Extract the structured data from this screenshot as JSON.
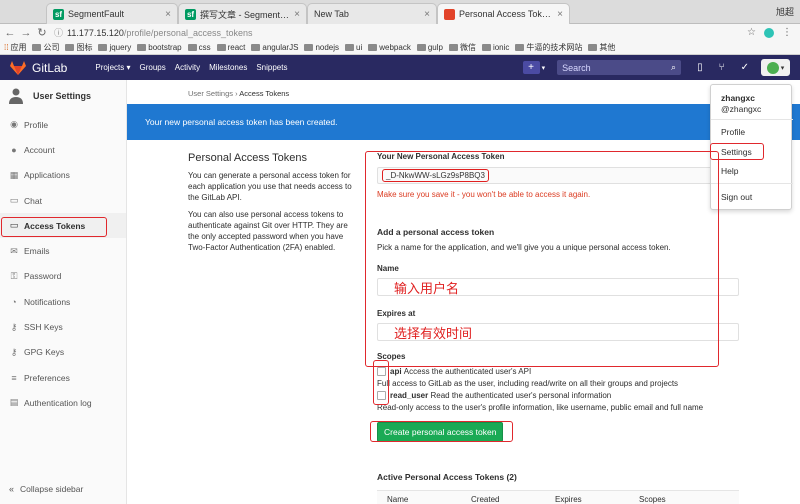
{
  "browser": {
    "tabs": [
      {
        "label": "SegmentFault",
        "favicon": "sf",
        "favicon_color": "#009a61",
        "active": false
      },
      {
        "label": "撰写文章 - SegmentFault",
        "favicon": "sf",
        "favicon_color": "#009a61",
        "active": false
      },
      {
        "label": "New Tab",
        "favicon": "",
        "favicon_color": "",
        "active": false
      },
      {
        "label": "Personal Access Tokens · User S",
        "favicon": "gitlab",
        "favicon_color": "#e24329",
        "active": true
      }
    ],
    "user_name": "旭超",
    "url_host": "11.177.15.120",
    "url_path": "/profile/personal_access_tokens",
    "bookmarks": [
      "应用",
      "公司",
      "图标",
      "jquery",
      "bootstrap",
      "css",
      "react",
      "angularJS",
      "nodejs",
      "ui",
      "webpack",
      "gulp",
      "微信",
      "ionic",
      "牛逼的技术网站",
      "其他"
    ]
  },
  "gitlab_nav": {
    "brand": "GitLab",
    "links": [
      "Projects ▾",
      "Groups",
      "Activity",
      "Milestones",
      "Snippets"
    ],
    "search_placeholder": "Search",
    "colors": {
      "navbar": "#292961",
      "accent": "#1f78d1",
      "success": "#1aaa55",
      "danger": "#db3b21"
    }
  },
  "sidebar": {
    "title": "User Settings",
    "items": [
      {
        "label": "Profile",
        "icon": "profile-icon",
        "active": false
      },
      {
        "label": "Account",
        "icon": "account-icon",
        "active": false
      },
      {
        "label": "Applications",
        "icon": "applications-icon",
        "active": false
      },
      {
        "label": "Chat",
        "icon": "chat-icon",
        "active": false
      },
      {
        "label": "Access Tokens",
        "icon": "access-tokens-icon",
        "active": true
      },
      {
        "label": "Emails",
        "icon": "emails-icon",
        "active": false
      },
      {
        "label": "Password",
        "icon": "password-icon",
        "active": false
      },
      {
        "label": "Notifications",
        "icon": "notifications-icon",
        "active": false
      },
      {
        "label": "SSH Keys",
        "icon": "ssh-keys-icon",
        "active": false
      },
      {
        "label": "GPG Keys",
        "icon": "gpg-keys-icon",
        "active": false
      },
      {
        "label": "Preferences",
        "icon": "preferences-icon",
        "active": false
      },
      {
        "label": "Authentication log",
        "icon": "authentication-log-icon",
        "active": false
      }
    ],
    "collapse_label": "Collapse sidebar"
  },
  "breadcrumb": {
    "parent": "User Settings",
    "current": "Access Tokens"
  },
  "flash": "Your new personal access token has been created.",
  "intro": {
    "title": "Personal Access Tokens",
    "p1": "You can generate a personal access token for each application you use that needs access to the GitLab API.",
    "p2": "You can also use personal access tokens to authenticate against Git over HTTP. They are the only accepted password when you have Two-Factor Authentication (2FA) enabled."
  },
  "form": {
    "new_token_label": "Your New Personal Access Token",
    "new_token_value": "_D-NkwWW-sLGz9sP8BQ3",
    "warning": "Make sure you save it - you won't be able to access it again.",
    "add_title": "Add a personal access token",
    "add_hint": "Pick a name for the application, and we'll give you a unique personal access token.",
    "name_label": "Name",
    "name_value": "输入用户名",
    "expires_label": "Expires at",
    "expires_value": "选择有效时间",
    "scopes_label": "Scopes",
    "scopes": [
      {
        "name": "api",
        "summary": "Access the authenticated user's API",
        "description": "Full access to GitLab as the user, including read/write on all their groups and projects"
      },
      {
        "name": "read_user",
        "summary": "Read the authenticated user's personal information",
        "description": "Read-only access to the user's profile information, like username, public email and full name"
      }
    ],
    "create_button": "Create personal access token",
    "active_title": "Active Personal Access Tokens (2)",
    "table_headers": [
      "Name",
      "Created",
      "Expires",
      "Scopes"
    ]
  },
  "user_menu": {
    "name": "zhangxc",
    "handle": "@zhangxc",
    "items": [
      "Profile",
      "Settings",
      "Help",
      "Sign out"
    ]
  }
}
